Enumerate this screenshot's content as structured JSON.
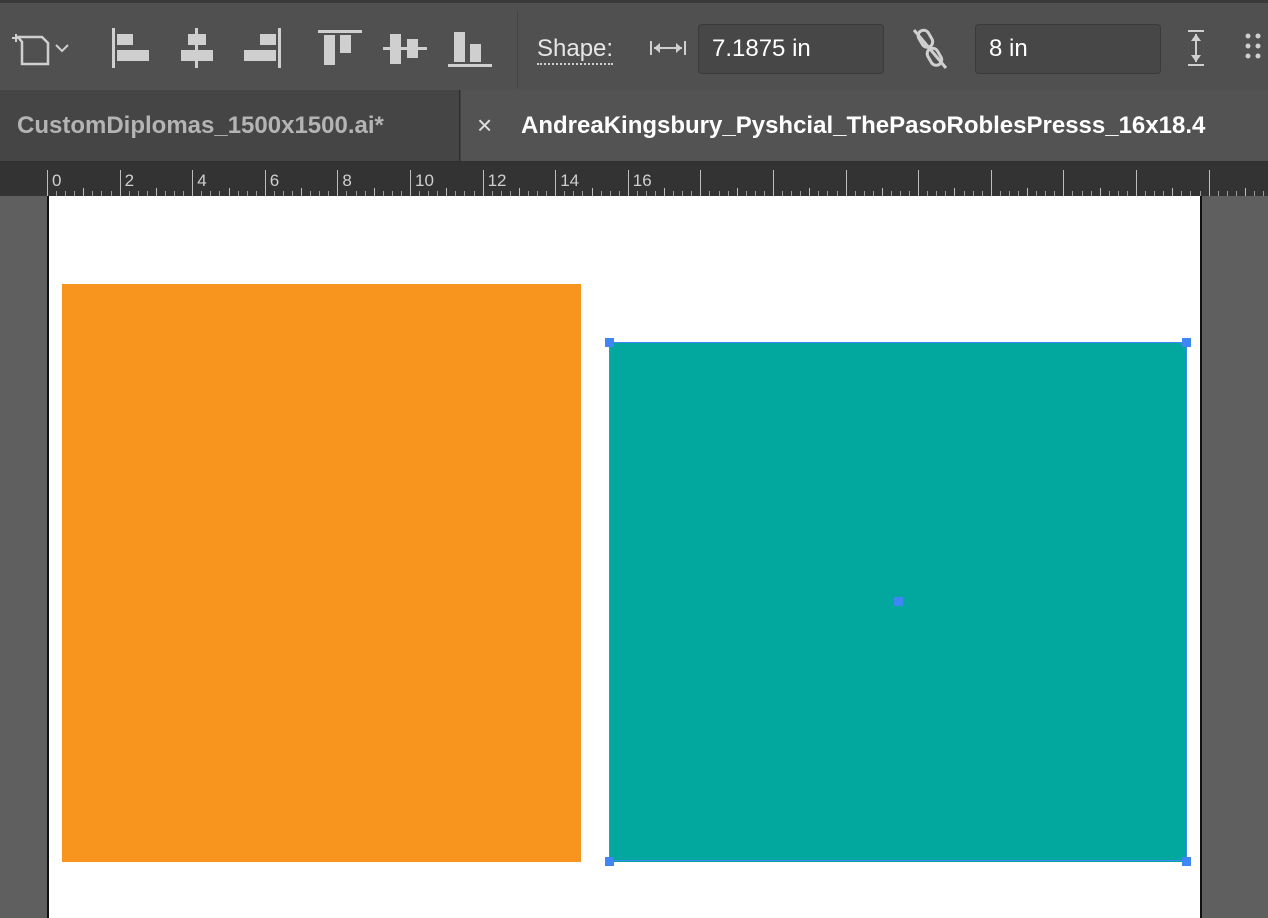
{
  "control_bar": {
    "shape_label": "Shape:",
    "width_value": "7.1875 in",
    "height_value": "8 in",
    "icons": [
      "artboard-shape-icon",
      "chevron-down-icon",
      "align-left-icon",
      "align-horizontal-center-icon",
      "align-right-icon",
      "align-top-icon",
      "align-vertical-center-icon",
      "align-bottom-icon",
      "width-arrows-icon",
      "unlink-proportions-icon",
      "height-arrows-icon",
      "more-options-icon"
    ]
  },
  "tabs": [
    {
      "label": "CustomDiplomas_1500x1500.ai*",
      "active": false
    },
    {
      "label": "AndreaKingsbury_Pyshcial_ThePasoRoblesPresss_16x18.4",
      "active": true,
      "close_symbol": "×"
    }
  ],
  "ruler": {
    "labels": [
      "0",
      "2",
      "4",
      "6",
      "8",
      "10",
      "12",
      "14",
      "16"
    ]
  },
  "canvas": {
    "colors": {
      "orange": "#f7951e",
      "teal": "#02a89d",
      "selection": "#3f86f7",
      "artboard": "#ffffff",
      "pasteboard": "#5f5f5f"
    }
  }
}
